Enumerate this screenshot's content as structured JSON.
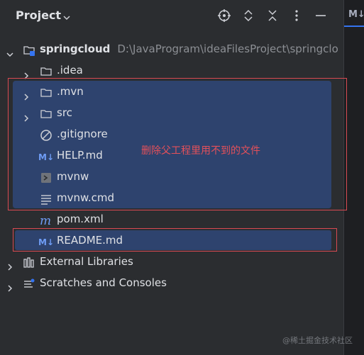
{
  "header": {
    "title": "Project"
  },
  "right_strip": {
    "tab_fragment": "M↓"
  },
  "tree": {
    "root": {
      "name": "springcloud",
      "path": "D:\\JavaProgram\\ideaFilesProject\\springclo"
    },
    "items": [
      {
        "label": ".idea",
        "icon": "folder-icon"
      },
      {
        "label": ".mvn",
        "icon": "folder-icon"
      },
      {
        "label": "src",
        "icon": "folder-icon"
      },
      {
        "label": ".gitignore",
        "icon": "gitignore-icon"
      },
      {
        "label": "HELP.md",
        "icon": "markdown-icon"
      },
      {
        "label": "mvnw",
        "icon": "shell-script-icon"
      },
      {
        "label": "mvnw.cmd",
        "icon": "text-file-icon"
      },
      {
        "label": "pom.xml",
        "icon": "maven-icon"
      },
      {
        "label": "README.md",
        "icon": "markdown-icon"
      }
    ],
    "external_libraries": "External Libraries",
    "scratches": "Scratches and Consoles"
  },
  "annotation": {
    "text": "删除父工程里用不到的文件"
  },
  "watermark": "@稀土掘金技术社区",
  "colors": {
    "background": "#2b2d30",
    "selection": "#2e436e",
    "annotation_red": "#d94a52",
    "accent": "#3574f0"
  }
}
